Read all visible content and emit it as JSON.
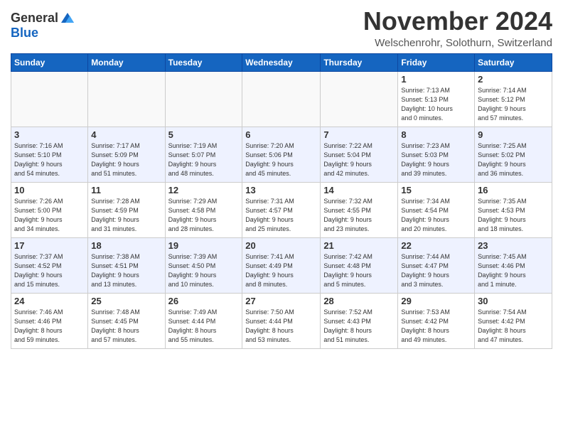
{
  "header": {
    "logo_general": "General",
    "logo_blue": "Blue",
    "month_title": "November 2024",
    "location": "Welschenrohr, Solothurn, Switzerland"
  },
  "weekdays": [
    "Sunday",
    "Monday",
    "Tuesday",
    "Wednesday",
    "Thursday",
    "Friday",
    "Saturday"
  ],
  "weeks": [
    [
      {
        "day": "",
        "info": ""
      },
      {
        "day": "",
        "info": ""
      },
      {
        "day": "",
        "info": ""
      },
      {
        "day": "",
        "info": ""
      },
      {
        "day": "",
        "info": ""
      },
      {
        "day": "1",
        "info": "Sunrise: 7:13 AM\nSunset: 5:13 PM\nDaylight: 10 hours\nand 0 minutes."
      },
      {
        "day": "2",
        "info": "Sunrise: 7:14 AM\nSunset: 5:12 PM\nDaylight: 9 hours\nand 57 minutes."
      }
    ],
    [
      {
        "day": "3",
        "info": "Sunrise: 7:16 AM\nSunset: 5:10 PM\nDaylight: 9 hours\nand 54 minutes."
      },
      {
        "day": "4",
        "info": "Sunrise: 7:17 AM\nSunset: 5:09 PM\nDaylight: 9 hours\nand 51 minutes."
      },
      {
        "day": "5",
        "info": "Sunrise: 7:19 AM\nSunset: 5:07 PM\nDaylight: 9 hours\nand 48 minutes."
      },
      {
        "day": "6",
        "info": "Sunrise: 7:20 AM\nSunset: 5:06 PM\nDaylight: 9 hours\nand 45 minutes."
      },
      {
        "day": "7",
        "info": "Sunrise: 7:22 AM\nSunset: 5:04 PM\nDaylight: 9 hours\nand 42 minutes."
      },
      {
        "day": "8",
        "info": "Sunrise: 7:23 AM\nSunset: 5:03 PM\nDaylight: 9 hours\nand 39 minutes."
      },
      {
        "day": "9",
        "info": "Sunrise: 7:25 AM\nSunset: 5:02 PM\nDaylight: 9 hours\nand 36 minutes."
      }
    ],
    [
      {
        "day": "10",
        "info": "Sunrise: 7:26 AM\nSunset: 5:00 PM\nDaylight: 9 hours\nand 34 minutes."
      },
      {
        "day": "11",
        "info": "Sunrise: 7:28 AM\nSunset: 4:59 PM\nDaylight: 9 hours\nand 31 minutes."
      },
      {
        "day": "12",
        "info": "Sunrise: 7:29 AM\nSunset: 4:58 PM\nDaylight: 9 hours\nand 28 minutes."
      },
      {
        "day": "13",
        "info": "Sunrise: 7:31 AM\nSunset: 4:57 PM\nDaylight: 9 hours\nand 25 minutes."
      },
      {
        "day": "14",
        "info": "Sunrise: 7:32 AM\nSunset: 4:55 PM\nDaylight: 9 hours\nand 23 minutes."
      },
      {
        "day": "15",
        "info": "Sunrise: 7:34 AM\nSunset: 4:54 PM\nDaylight: 9 hours\nand 20 minutes."
      },
      {
        "day": "16",
        "info": "Sunrise: 7:35 AM\nSunset: 4:53 PM\nDaylight: 9 hours\nand 18 minutes."
      }
    ],
    [
      {
        "day": "17",
        "info": "Sunrise: 7:37 AM\nSunset: 4:52 PM\nDaylight: 9 hours\nand 15 minutes."
      },
      {
        "day": "18",
        "info": "Sunrise: 7:38 AM\nSunset: 4:51 PM\nDaylight: 9 hours\nand 13 minutes."
      },
      {
        "day": "19",
        "info": "Sunrise: 7:39 AM\nSunset: 4:50 PM\nDaylight: 9 hours\nand 10 minutes."
      },
      {
        "day": "20",
        "info": "Sunrise: 7:41 AM\nSunset: 4:49 PM\nDaylight: 9 hours\nand 8 minutes."
      },
      {
        "day": "21",
        "info": "Sunrise: 7:42 AM\nSunset: 4:48 PM\nDaylight: 9 hours\nand 5 minutes."
      },
      {
        "day": "22",
        "info": "Sunrise: 7:44 AM\nSunset: 4:47 PM\nDaylight: 9 hours\nand 3 minutes."
      },
      {
        "day": "23",
        "info": "Sunrise: 7:45 AM\nSunset: 4:46 PM\nDaylight: 9 hours\nand 1 minute."
      }
    ],
    [
      {
        "day": "24",
        "info": "Sunrise: 7:46 AM\nSunset: 4:46 PM\nDaylight: 8 hours\nand 59 minutes."
      },
      {
        "day": "25",
        "info": "Sunrise: 7:48 AM\nSunset: 4:45 PM\nDaylight: 8 hours\nand 57 minutes."
      },
      {
        "day": "26",
        "info": "Sunrise: 7:49 AM\nSunset: 4:44 PM\nDaylight: 8 hours\nand 55 minutes."
      },
      {
        "day": "27",
        "info": "Sunrise: 7:50 AM\nSunset: 4:44 PM\nDaylight: 8 hours\nand 53 minutes."
      },
      {
        "day": "28",
        "info": "Sunrise: 7:52 AM\nSunset: 4:43 PM\nDaylight: 8 hours\nand 51 minutes."
      },
      {
        "day": "29",
        "info": "Sunrise: 7:53 AM\nSunset: 4:42 PM\nDaylight: 8 hours\nand 49 minutes."
      },
      {
        "day": "30",
        "info": "Sunrise: 7:54 AM\nSunset: 4:42 PM\nDaylight: 8 hours\nand 47 minutes."
      }
    ]
  ]
}
